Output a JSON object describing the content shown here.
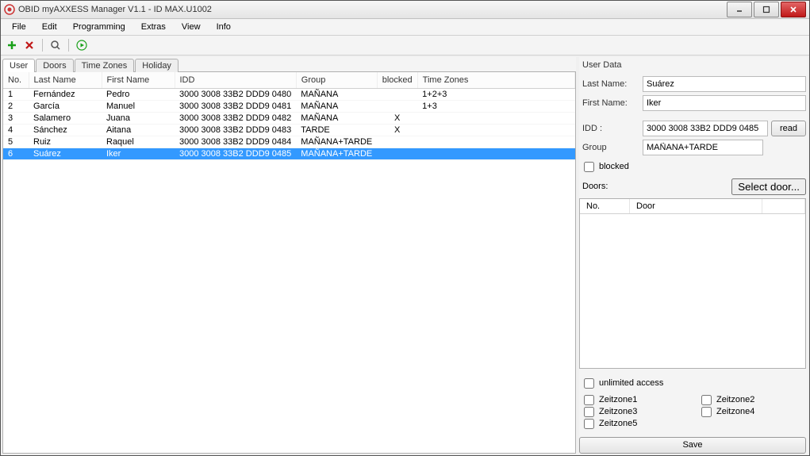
{
  "window": {
    "title": "OBID myAXXESS Manager V1.1 - ID MAX.U1002"
  },
  "menu": [
    "File",
    "Edit",
    "Programming",
    "Extras",
    "View",
    "Info"
  ],
  "toolbar": {
    "add_icon": "plus-icon",
    "delete_icon": "x-icon",
    "search_icon": "magnifier-icon",
    "run_icon": "play-icon"
  },
  "tabs": [
    "User",
    "Doors",
    "Time Zones",
    "Holiday"
  ],
  "active_tab": "User",
  "table": {
    "headers": [
      "No.",
      "Last Name",
      "First Name",
      "IDD",
      "Group",
      "blocked",
      "Time Zones"
    ],
    "rows": [
      {
        "no": "1",
        "last": "Fernández",
        "first": "Pedro",
        "idd": "3000 3008 33B2 DDD9 0480",
        "group": "MAÑANA",
        "blocked": "",
        "tz": "1+2+3",
        "selected": false
      },
      {
        "no": "2",
        "last": "García",
        "first": "Manuel",
        "idd": "3000 3008 33B2 DDD9 0481",
        "group": "MAÑANA",
        "blocked": "",
        "tz": "1+3",
        "selected": false
      },
      {
        "no": "3",
        "last": "Salamero",
        "first": "Juana",
        "idd": "3000 3008 33B2 DDD9 0482",
        "group": "MAÑANA",
        "blocked": "X",
        "tz": "",
        "selected": false
      },
      {
        "no": "4",
        "last": "Sánchez",
        "first": "Aitana",
        "idd": "3000 3008 33B2 DDD9 0483",
        "group": "TARDE",
        "blocked": "X",
        "tz": "",
        "selected": false
      },
      {
        "no": "5",
        "last": "Ruiz",
        "first": "Raquel",
        "idd": "3000 3008 33B2 DDD9 0484",
        "group": "MAÑANA+TARDE",
        "blocked": "",
        "tz": "",
        "selected": false
      },
      {
        "no": "6",
        "last": "Suárez",
        "first": "Iker",
        "idd": "3000 3008 33B2 DDD9 0485",
        "group": "MAÑANA+TARDE",
        "blocked": "",
        "tz": "",
        "selected": true
      }
    ]
  },
  "user_data": {
    "title": "User Data",
    "labels": {
      "last_name": "Last Name:",
      "first_name": "First Name:",
      "idd": "IDD :",
      "group": "Group",
      "blocked": "blocked",
      "doors": "Doors:",
      "doors_no": "No.",
      "doors_door": "Door",
      "unlimited": "unlimited access"
    },
    "values": {
      "last_name": "Suárez",
      "first_name": "Iker",
      "idd": "3000 3008 33B2 DDD9 0485",
      "group": "MAÑANA+TARDE",
      "blocked": false,
      "unlimited": false
    },
    "buttons": {
      "read": "read",
      "select_door": "Select door...",
      "save": "Save"
    },
    "timezones": [
      "Zeitzone1",
      "Zeitzone2",
      "Zeitzone3",
      "Zeitzone4",
      "Zeitzone5"
    ]
  }
}
